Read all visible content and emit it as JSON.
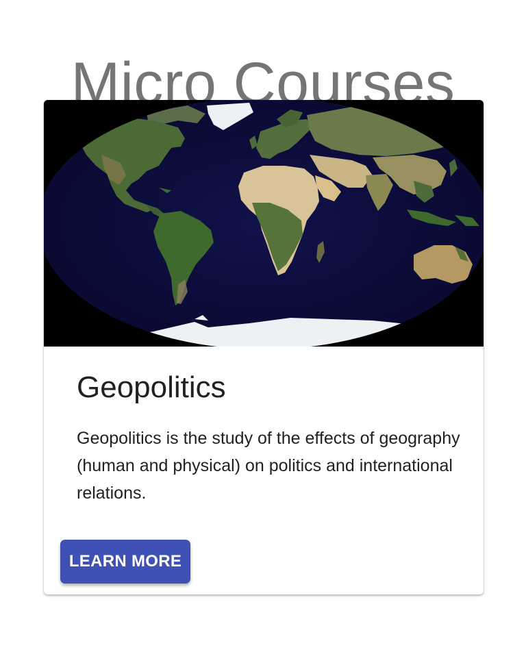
{
  "page": {
    "title": "Micro Courses"
  },
  "card": {
    "image": "world-map-satellite",
    "title": "Geopolitics",
    "description": "Geopolitics is the study of the effects of geography (human and physical) on politics and international relations.",
    "action_label": "LEARN MORE"
  },
  "colors": {
    "title_text": "#757575",
    "body_text": "#212121",
    "button": "#3f51b5",
    "ocean": "#0b0b3c",
    "land": "#4a6332",
    "desert": "#d9c49a",
    "ice": "#eef1f3"
  }
}
